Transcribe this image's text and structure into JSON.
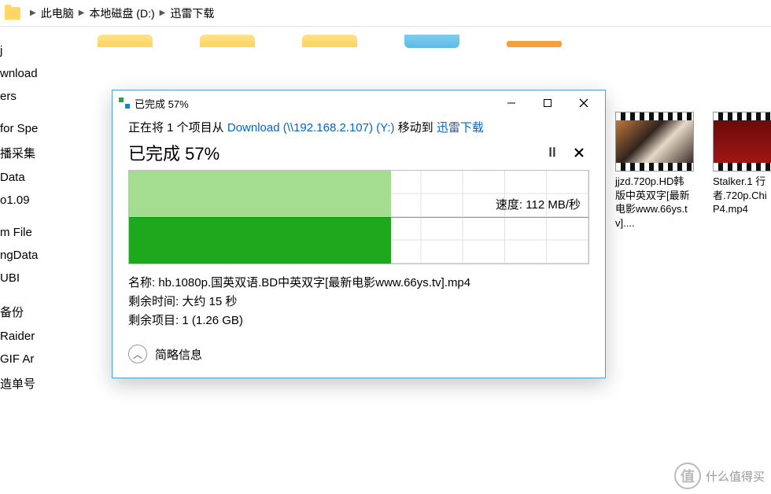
{
  "breadcrumb": {
    "items": [
      "此电脑",
      "本地磁盘 (D:)",
      "迅雷下载"
    ]
  },
  "sidebar": {
    "items": [
      "j",
      "wnload",
      "ers",
      "",
      "for Spe",
      "播采集",
      "Data",
      "o1.09",
      "",
      "m File",
      "ngData",
      "UBI",
      "",
      "备份",
      "Raider",
      "GIF Ar",
      "造单号"
    ]
  },
  "videos": [
    {
      "caption": "jjzd.720p.HD韩版中英双字[最新电影www.66ys.tv]...."
    },
    {
      "caption": "Stalker.1\n行者.720p.Chi\nP4.mp4"
    }
  ],
  "dialog": {
    "title": "已完成 57%",
    "move_prefix": "正在将 1 个项目从 ",
    "source_link": "Download (\\\\192.168.2.107) (Y:)",
    "move_mid": " 移动到 ",
    "dest_link": "迅雷下载",
    "status": "已完成 57%",
    "speed_label": "速度: ",
    "speed_value": "112 MB/秒",
    "name_label": "名称: ",
    "name_value": "hb.1080p.国英双语.BD中英双字[最新电影www.66ys.tv].mp4",
    "remain_time_label": "剩余时间: ",
    "remain_time_value": "大约 15 秒",
    "remain_items_label": "剩余项目: ",
    "remain_items_value": "1 (1.26 GB)",
    "less_info": "简略信息",
    "progress_percent": 57
  },
  "watermark": {
    "badge": "值",
    "text": "什么值得买"
  }
}
